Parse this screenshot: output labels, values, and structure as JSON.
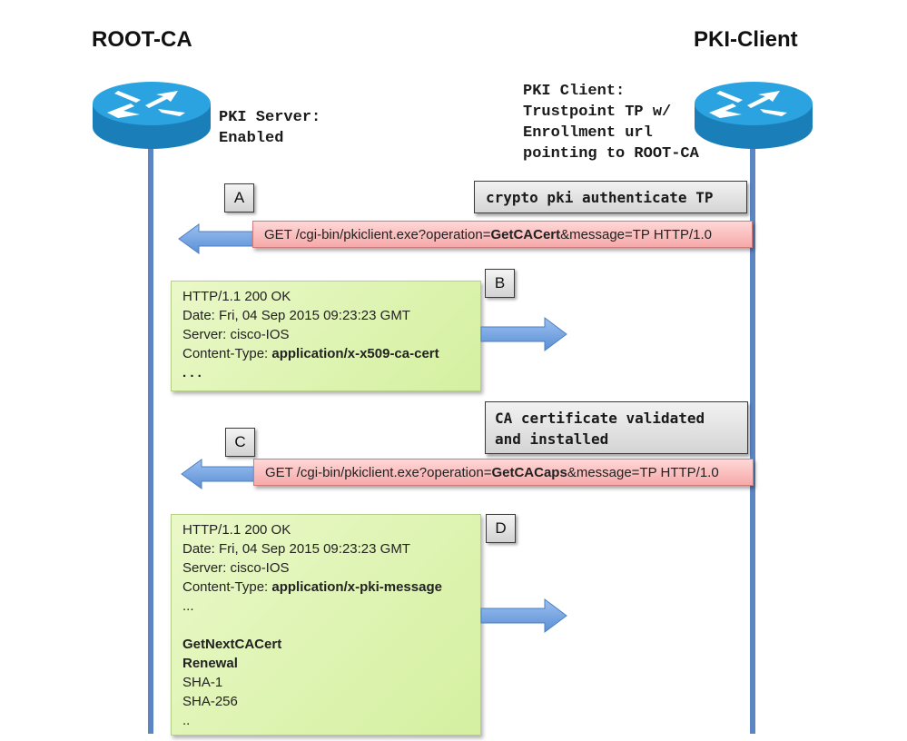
{
  "nodes": {
    "root_ca": {
      "title": "ROOT-CA",
      "note": [
        "PKI Server:",
        "Enabled"
      ]
    },
    "pki_client": {
      "title": "PKI-Client",
      "note": [
        "PKI Client:",
        "Trustpoint TP w/",
        "Enrollment url",
        "pointing to ROOT-CA"
      ]
    }
  },
  "colors": {
    "lifeline": "#5b85c3",
    "router": "#1f8fd0",
    "request_box": "#f8b4b4",
    "response_box": "#dcf3ae",
    "arrow": "#6e9ee0"
  },
  "steps": [
    {
      "label": "A",
      "command": "crypto pki authenticate TP",
      "request": {
        "prefix": "GET /cgi-bin/pkiclient.exe?operation=",
        "operation": "GetCACert",
        "suffix": "&message=TP HTTP/1.0"
      },
      "direction": "client-to-server"
    },
    {
      "label": "B",
      "response": {
        "status": "HTTP/1.1 200 OK",
        "date": "Date: Fri, 04 Sep 2015 09:23:23 GMT",
        "server": "Server: cisco-IOS",
        "content_type_label": "Content-Type: ",
        "content_type_value": "application/x-x509-ca-cert",
        "ellipsis": ". . ."
      },
      "direction": "server-to-client"
    },
    {
      "label": "C",
      "command": [
        "CA certificate validated",
        "and installed"
      ],
      "request": {
        "prefix": "GET /cgi-bin/pkiclient.exe?operation=",
        "operation": "GetCACaps",
        "suffix": "&message=TP HTTP/1.0"
      },
      "direction": "client-to-server"
    },
    {
      "label": "D",
      "response": {
        "status": "HTTP/1.1 200 OK",
        "date": "Date: Fri, 04 Sep 2015 09:23:23 GMT",
        "server": "Server: cisco-IOS",
        "content_type_label": "Content-Type: ",
        "content_type_value": "application/x-pki-message",
        "ellipsis": "...",
        "capabilities_bold": [
          "GetNextCACert",
          "Renewal"
        ],
        "capabilities": [
          "SHA-1",
          "SHA-256"
        ],
        "trailing": ".."
      },
      "direction": "server-to-client"
    }
  ]
}
